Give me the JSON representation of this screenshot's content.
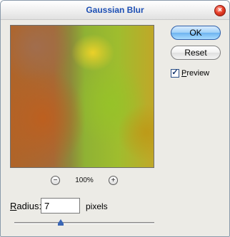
{
  "window": {
    "title": "Gaussian Blur"
  },
  "preview_pane": {
    "zoom_level": "100%",
    "zoom_out_symbol": "−",
    "zoom_in_symbol": "+"
  },
  "buttons": {
    "ok_label": "OK",
    "reset_label": "Reset"
  },
  "preview_toggle": {
    "label_first": "P",
    "label_rest": "review",
    "checked": true
  },
  "radius": {
    "label_first": "R",
    "label_rest": "adius:",
    "value": "7",
    "unit": "pixels"
  },
  "slider": {
    "min": 0.1,
    "max": 250,
    "value": 7,
    "position_fraction": 0.33
  },
  "colors": {
    "title_text": "#1d4fb4",
    "ok_accent": "#6db3ef",
    "close_button": "#e8402a",
    "slider_thumb": "#3a66b5"
  }
}
